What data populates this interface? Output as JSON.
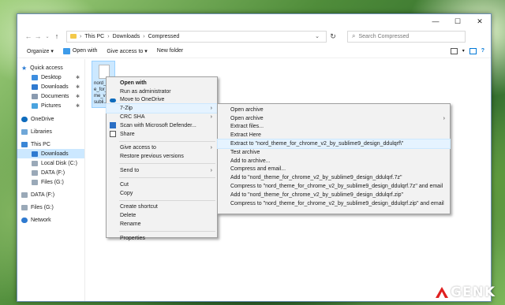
{
  "colors": {
    "accent": "#0078d7",
    "selection": "#cce8ff",
    "folder": "#f3c94a",
    "wallpaper": "#4f8c3a"
  },
  "window": {
    "controls": {
      "minimize": "—",
      "maximize": "☐",
      "close": "✕"
    }
  },
  "address": {
    "breadcrumbs": [
      "This PC",
      "Downloads",
      "Compressed"
    ],
    "search_placeholder": "Search Compressed"
  },
  "toolbar": {
    "organize": "Organize ▾",
    "open_with": "Open with",
    "give_access": "Give access to ▾",
    "new_folder": "New folder"
  },
  "sidebar": {
    "items": [
      {
        "label": "Quick access",
        "icon": "star-icon"
      },
      {
        "label": "Desktop",
        "icon": "desktop-icon",
        "pinned": true
      },
      {
        "label": "Downloads",
        "icon": "download-icon",
        "pinned": true
      },
      {
        "label": "Documents",
        "icon": "documents-icon",
        "pinned": true
      },
      {
        "label": "Pictures",
        "icon": "pictures-icon",
        "pinned": true
      },
      {
        "label": "OneDrive",
        "icon": "onedrive-icon"
      },
      {
        "label": "Libraries",
        "icon": "libraries-icon"
      },
      {
        "label": "This PC",
        "icon": "pc-icon"
      },
      {
        "label": "Downloads",
        "icon": "download-icon",
        "selected": true
      },
      {
        "label": "Local Disk (C:)",
        "icon": "drive-icon"
      },
      {
        "label": "DATA (F:)",
        "icon": "drive-icon"
      },
      {
        "label": "Files (G:)",
        "icon": "drive-icon"
      },
      {
        "label": "DATA (F:)",
        "icon": "drive-icon"
      },
      {
        "label": "Files (G:)",
        "icon": "drive-icon"
      },
      {
        "label": "Network",
        "icon": "network-icon"
      }
    ]
  },
  "file": {
    "name": "nord_th\ne_for_\nme_v\nsubli..."
  },
  "context_menu": {
    "items": [
      {
        "label": "Open with",
        "bold": true
      },
      {
        "label": "Run as administrator"
      },
      {
        "label": "Move to OneDrive",
        "icon": "onedrive-icon"
      },
      {
        "label": "7-Zip",
        "submenu": true,
        "highlighted": true
      },
      {
        "label": "CRC SHA",
        "submenu": true
      },
      {
        "label": "Scan with Microsoft Defender...",
        "icon": "defender-icon"
      },
      {
        "label": "Share",
        "icon": "share-icon"
      },
      {
        "separator": true
      },
      {
        "label": "Give access to",
        "submenu": true
      },
      {
        "label": "Restore previous versions"
      },
      {
        "separator": true
      },
      {
        "label": "Send to",
        "submenu": true
      },
      {
        "separator": true
      },
      {
        "label": "Cut"
      },
      {
        "label": "Copy"
      },
      {
        "separator": true
      },
      {
        "label": "Create shortcut"
      },
      {
        "label": "Delete"
      },
      {
        "label": "Rename"
      },
      {
        "separator": true
      },
      {
        "label": "Properties"
      }
    ]
  },
  "submenu_7zip": {
    "items": [
      {
        "label": "Open archive"
      },
      {
        "label": "Open archive",
        "submenu": true
      },
      {
        "label": "Extract files..."
      },
      {
        "label": "Extract Here"
      },
      {
        "label": "Extract to \"nord_theme_for_chrome_v2_by_sublime9_design_ddulqrf\\\"",
        "highlighted": true
      },
      {
        "label": "Test archive"
      },
      {
        "label": "Add to archive..."
      },
      {
        "label": "Compress and email..."
      },
      {
        "label": "Add to \"nord_theme_for_chrome_v2_by_sublime9_design_ddulqrf.7z\""
      },
      {
        "label": "Compress to \"nord_theme_for_chrome_v2_by_sublime9_design_ddulqrf.7z\" and email"
      },
      {
        "label": "Add to \"nord_theme_for_chrome_v2_by_sublime9_design_ddulqrf.zip\""
      },
      {
        "label": "Compress to \"nord_theme_for_chrome_v2_by_sublime9_design_ddulqrf.zip\" and email"
      }
    ]
  },
  "watermark": {
    "text": "GENK"
  }
}
